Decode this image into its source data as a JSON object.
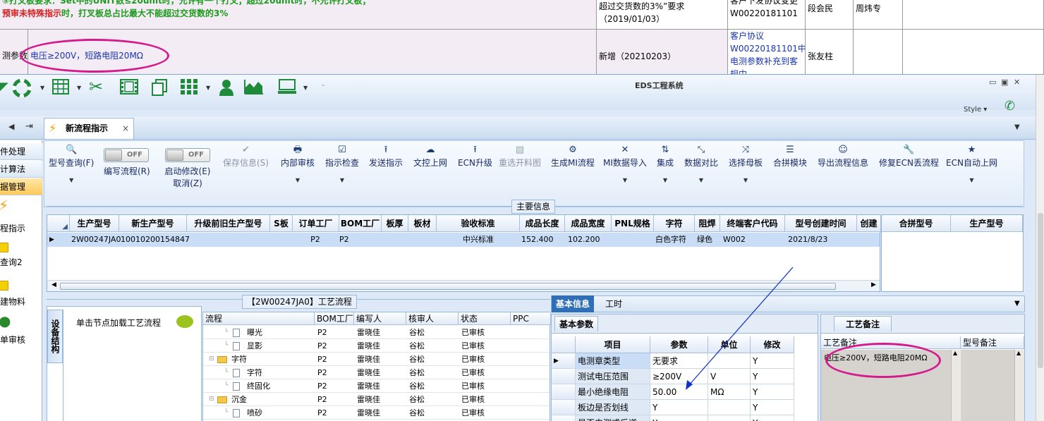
{
  "spreadsheet": {
    "row1_note_line1": "⑤打叉板要求：Set中的UNIT数≤20unit时，允许有一个打叉；超过20unit时，不允许打叉板；",
    "row1_note_line2_red": "预审未特殊指示",
    "row1_note_line2_rest": "时，打叉板总占比最大不能超过交货数的3%",
    "row1_change_line1": "超过交货数的3%”要求",
    "row1_change_line2": "（2019/01/03）",
    "row1_source_line1": "客户下发协议变更",
    "row1_source_line2": "W00220181101",
    "row1_person1": "段会民",
    "row1_person2": "周炜专",
    "row2_item": "测参数",
    "row2_value": "电压≥200V，短路电阻20MΩ",
    "row2_change": "新增（20210203）",
    "row2_source_line1": "客户协议",
    "row2_source_line2": "W00220181101中",
    "row2_source_line3": "电测参数补充到客",
    "row2_source_line4": "规中",
    "row2_person": "张友柱"
  },
  "app": {
    "title": "EDS工程系统",
    "style_label": "Style",
    "active_tab": "新流程指示",
    "tab_close": "×"
  },
  "quick_access": [
    "lifebuoy-icon",
    "table-icon",
    "scissors-icon",
    "film-icon",
    "copy-icon",
    "grid-icon",
    "user-icon",
    "chart-icon",
    "monitor-icon"
  ],
  "left_nav": {
    "items": [
      {
        "label": "件处理"
      },
      {
        "label": "计算法"
      },
      {
        "label": "据管理"
      }
    ],
    "icon_items": [
      {
        "label": "程指示"
      },
      {
        "label": "查询2"
      },
      {
        "label": "建物料"
      },
      {
        "label": "单审核"
      }
    ]
  },
  "ribbon": {
    "buttons": [
      {
        "label": "型号查询(F)",
        "enabled": true
      },
      {
        "label": "编写流程(R)",
        "toggle": "OFF"
      },
      {
        "label": "启动修改(E)",
        "toggle": "OFF",
        "sub": "取消(Z)"
      },
      {
        "label": "保存信息(S)",
        "enabled": false
      },
      {
        "label": "内部审核"
      },
      {
        "label": "指示检查"
      },
      {
        "label": "发送指示"
      },
      {
        "label": "文控上网"
      },
      {
        "label": "ECN升级"
      },
      {
        "label": "重选开料图",
        "enabled": false
      },
      {
        "label": "生成MI流程"
      },
      {
        "label": "MI数据导入"
      },
      {
        "label": "集成"
      },
      {
        "label": "数据对比"
      },
      {
        "label": "选择母板"
      },
      {
        "label": "合拼模块"
      },
      {
        "label": "导出流程信息"
      },
      {
        "label": "修复ECN丢流程"
      },
      {
        "label": "ECN自动上网"
      }
    ]
  },
  "main_info": {
    "group_title": "主要信息",
    "columns": [
      "生产型号",
      "新生产型号",
      "升级前旧生产型号",
      "S板",
      "订单工厂",
      "BOM工厂",
      "板厚",
      "板材",
      "验收标准",
      "成品长度",
      "成品宽度",
      "PNL规格",
      "字符",
      "阻焊",
      "终端客户代码",
      "型号创建时间",
      "创建"
    ],
    "row": [
      "2W00247JA0",
      "10010200154847",
      "",
      "",
      "P2",
      "P2",
      "",
      "",
      "中兴标准",
      "152.400",
      "102.200",
      "",
      "白色字符",
      "绿色",
      "W002",
      "2021/8/23",
      ""
    ],
    "side_columns": [
      "合拼型号",
      "生产型号"
    ]
  },
  "process": {
    "group_title": "【2W00247JA0】工艺流程",
    "side_tab": "设备结构",
    "hint": "单击节点加载工艺流程",
    "columns": [
      "流程",
      "BOM工厂",
      "编写人",
      "核审人",
      "状态",
      "PPC"
    ],
    "rows": [
      {
        "name": "曝光",
        "level": 2,
        "factory": "P2",
        "writer": "雷晓佳",
        "reviewer": "谷松",
        "status": "已审核"
      },
      {
        "name": "显影",
        "level": 2,
        "factory": "P2",
        "writer": "雷晓佳",
        "reviewer": "谷松",
        "status": "已审核"
      },
      {
        "name": "字符",
        "level": 1,
        "factory": "P2",
        "writer": "雷晓佳",
        "reviewer": "谷松",
        "status": "已审核"
      },
      {
        "name": "字符",
        "level": 2,
        "factory": "P2",
        "writer": "雷晓佳",
        "reviewer": "谷松",
        "status": "已审核"
      },
      {
        "name": "终固化",
        "level": 2,
        "factory": "P2",
        "writer": "雷晓佳",
        "reviewer": "谷松",
        "status": "已审核"
      },
      {
        "name": "沉金",
        "level": 1,
        "factory": "P2",
        "writer": "雷晓佳",
        "reviewer": "谷松",
        "status": "已审核"
      },
      {
        "name": "喷砂",
        "level": 2,
        "factory": "P2",
        "writer": "雷晓佳",
        "reviewer": "谷松",
        "status": "已审核"
      }
    ]
  },
  "detail": {
    "tabs": [
      "基本信息",
      "工时"
    ],
    "subtab": "基本参数",
    "columns": [
      "项目",
      "参数",
      "单位",
      "修改"
    ],
    "rows": [
      {
        "item": "电测章类型",
        "param": "无要求",
        "unit": "",
        "mod": "Y"
      },
      {
        "item": "测试电压范围",
        "param": "≥200V",
        "unit": "V",
        "mod": "Y"
      },
      {
        "item": "最小绝缘电阻",
        "param": "50.00",
        "unit": "MΩ",
        "mod": "Y"
      },
      {
        "item": "板边是否划线",
        "param": "Y",
        "unit": "",
        "mod": "Y"
      },
      {
        "item": "是否电测或后道",
        "param": "Y",
        "unit": "",
        "mod": "Y"
      }
    ]
  },
  "notes": {
    "tab": "工艺备注",
    "col1": "工艺备注",
    "col2": "型号备注",
    "value": "电压≥200V，短路电阻20MΩ"
  }
}
